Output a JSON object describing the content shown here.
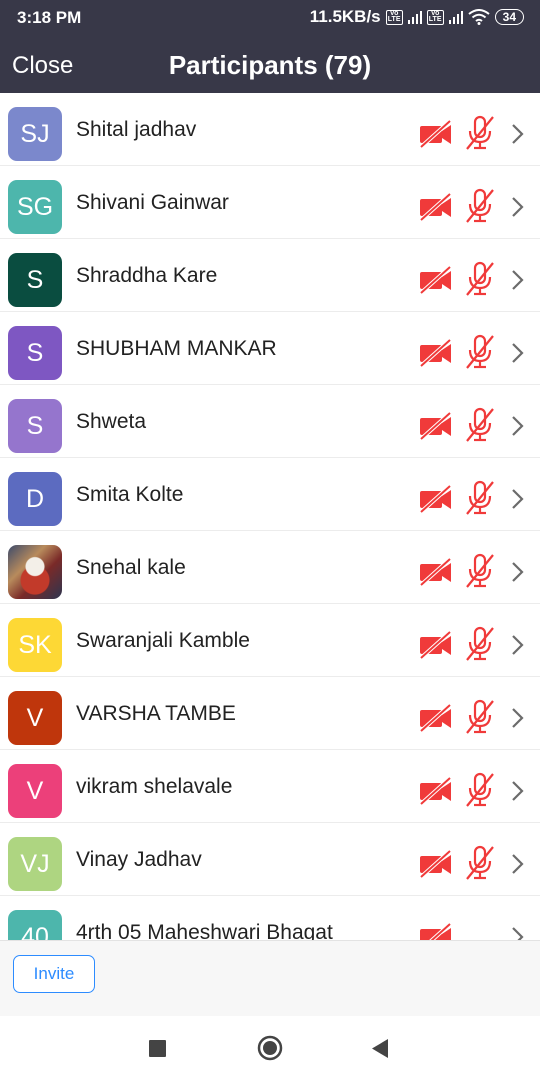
{
  "status_bar": {
    "time": "3:18 PM",
    "network_speed": "11.5KB/s",
    "volte_1": "Vo LTE",
    "volte_2": "Vo LTE",
    "battery": "34"
  },
  "header": {
    "close_label": "Close",
    "title": "Participants (79)"
  },
  "participants": [
    {
      "initials": "SJ",
      "name": "Shital jadhav",
      "avatar_color": "#7b88cc"
    },
    {
      "initials": "SG",
      "name": "Shivani Gainwar",
      "avatar_color": "#4db6ac"
    },
    {
      "initials": "S",
      "name": "Shraddha Kare",
      "avatar_color": "#0a4d40"
    },
    {
      "initials": "S",
      "name": "SHUBHAM MANKAR",
      "avatar_color": "#7e57c2"
    },
    {
      "initials": "S",
      "name": "Shweta",
      "avatar_color": "#9575cd"
    },
    {
      "initials": "D",
      "name": "Smita Kolte",
      "avatar_color": "#5c6bc0"
    },
    {
      "initials": "",
      "name": "Snehal kale",
      "avatar_color": "#6b4a3a"
    },
    {
      "initials": "SK",
      "name": "Swaranjali Kamble",
      "avatar_color": "#fdd835"
    },
    {
      "initials": "V",
      "name": "VARSHA TAMBE",
      "avatar_color": "#bf360c"
    },
    {
      "initials": "V",
      "name": "vikram shelavale",
      "avatar_color": "#ec407a"
    },
    {
      "initials": "VJ",
      "name": "Vinay Jadhav",
      "avatar_color": "#aed581"
    },
    {
      "initials": "40",
      "name": "4rth 05 Maheshwari Bhagat",
      "avatar_color": "#4db6ac"
    }
  ],
  "footer": {
    "invite_label": "Invite"
  },
  "colors": {
    "header_bg": "#383848",
    "muted_red": "#f03a3a",
    "accent_blue": "#2d8cff"
  }
}
